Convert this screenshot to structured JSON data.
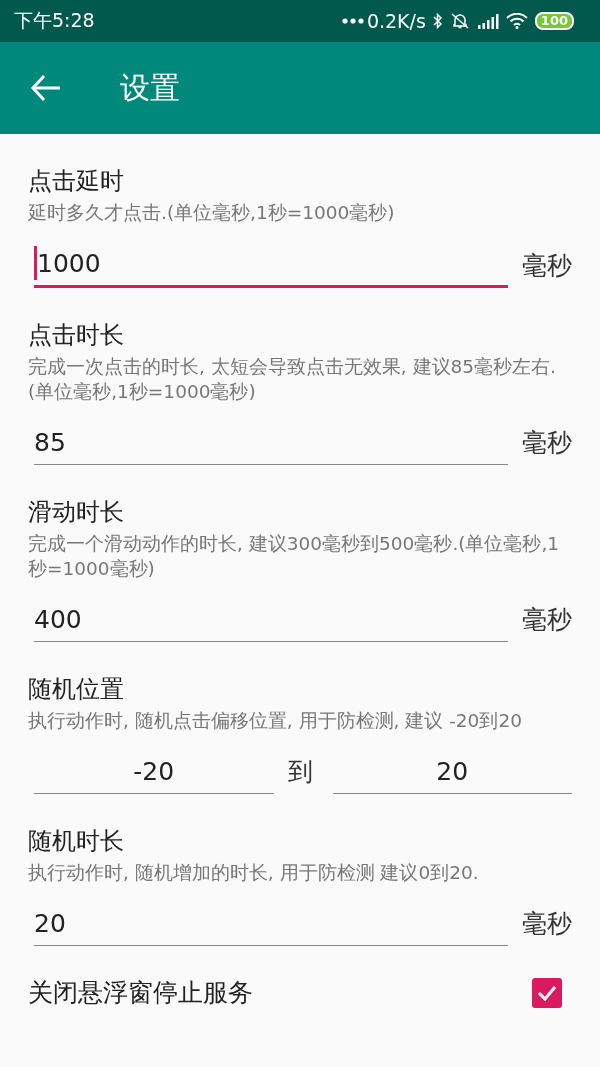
{
  "status_bar": {
    "time": "下午5:28",
    "net_speed": "0.2K/s",
    "battery": "100"
  },
  "toolbar": {
    "title": "设置"
  },
  "settings": [
    {
      "kind": "single",
      "title": "点击延时",
      "description": "延时多久才点击.(单位毫秒,1秒=1000毫秒)",
      "value": "1000",
      "unit": "毫秒",
      "focused": true
    },
    {
      "kind": "single",
      "title": "点击时长",
      "description": "完成一次点击的时长, 太短会导致点击无效果, 建议85毫秒左右.(单位毫秒,1秒=1000毫秒)",
      "value": "85",
      "unit": "毫秒",
      "focused": false
    },
    {
      "kind": "single",
      "title": "滑动时长",
      "description": "完成一个滑动动作的时长, 建议300毫秒到500毫秒.(单位毫秒,1秒=1000毫秒)",
      "value": "400",
      "unit": "毫秒",
      "focused": false
    },
    {
      "kind": "range",
      "title": "随机位置",
      "description": "执行动作时, 随机点击偏移位置, 用于防检测, 建议 -20到20",
      "from": "-20",
      "separator": "到",
      "to": "20"
    },
    {
      "kind": "single",
      "title": "随机时长",
      "description": "执行动作时, 随机增加的时长, 用于防检测 建议0到20.",
      "value": "20",
      "unit": "毫秒",
      "focused": false
    },
    {
      "kind": "checkbox",
      "title": "关闭悬浮窗停止服务",
      "checked": true
    }
  ]
}
